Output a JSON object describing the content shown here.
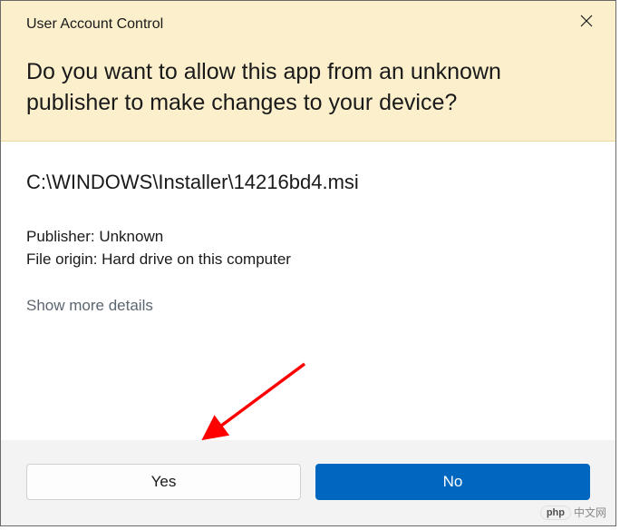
{
  "header": {
    "title": "User Account Control",
    "prompt": "Do you want to allow this app from an unknown publisher to make changes to your device?"
  },
  "body": {
    "app_path": "C:\\WINDOWS\\Installer\\14216bd4.msi",
    "publisher_label": "Publisher: Unknown",
    "file_origin_label": "File origin: Hard drive on this computer",
    "show_more": "Show more details"
  },
  "buttons": {
    "yes": "Yes",
    "no": "No"
  },
  "watermark": {
    "badge": "php",
    "text": "中文网"
  }
}
